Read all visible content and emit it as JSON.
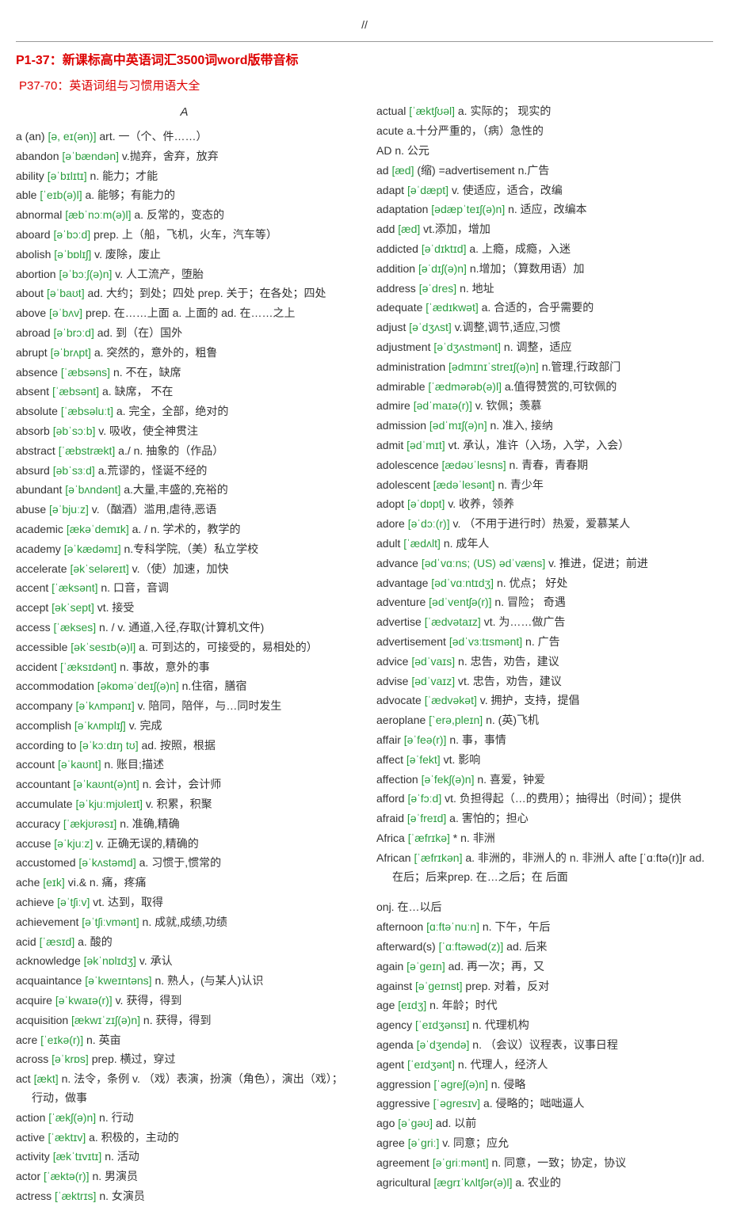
{
  "pageNum": "//",
  "title1": "P1-37：新课标高中英语词汇3500词word版带音标",
  "title2": "P37-70：英语词组与习惯用语大全",
  "sectionHeader": "A",
  "entries": [
    {
      "w": "a (an)",
      "p": "[ə, eɪ(ən)]",
      "d": "art. 一（个、件……）"
    },
    {
      "w": "abandon",
      "p": "[əˈbændən]",
      "d": "v.抛弃，舍弃，放弃"
    },
    {
      "w": "ability",
      "p": "[əˈbɪlɪtɪ]",
      "d": "n. 能力；才能"
    },
    {
      "w": "able",
      "p": "[ˈeɪb(ə)l]",
      "d": "a. 能够；有能力的"
    },
    {
      "w": "abnormal",
      "p": "[æbˈnɔːm(ə)l]",
      "d": "a. 反常的，变态的"
    },
    {
      "w": "aboard",
      "p": "[əˈbɔːd]",
      "d": "prep. 上（船，飞机，火车，汽车等）"
    },
    {
      "w": "abolish",
      "p": "[əˈbɒlɪʃ]",
      "d": "v. 废除，废止"
    },
    {
      "w": "abortion",
      "p": "[əˈbɔːʃ(ə)n]",
      "d": "v. 人工流产，堕胎"
    },
    {
      "w": "about",
      "p": "[əˈbaʊt]",
      "d": "ad. 大约；到处；四处 prep. 关于；在各处；四处"
    },
    {
      "w": "above",
      "p": "[əˈbʌv]",
      "d": "prep. 在……上面 a. 上面的 ad. 在……之上"
    },
    {
      "w": "abroad",
      "p": "[əˈbrɔːd]",
      "d": "ad. 到（在）国外"
    },
    {
      "w": "abrupt",
      "p": "[əˈbrʌpt]",
      "d": "a. 突然的，意外的，粗鲁"
    },
    {
      "w": "absence",
      "p": "[ˈæbsəns]",
      "d": "n. 不在，缺席"
    },
    {
      "w": "absent",
      "p": "[ˈæbsənt]",
      "d": "a. 缺席， 不在"
    },
    {
      "w": "absolute",
      "p": "[ˈæbsəluːt]",
      "d": "a. 完全，全部，绝对的"
    },
    {
      "w": "absorb",
      "p": "[əbˈsɔːb]",
      "d": "v. 吸收，使全神贯注"
    },
    {
      "w": "abstract",
      "p": "[ˈæbstrækt]",
      "d": "a./ n. 抽象的（作品）"
    },
    {
      "w": "absurd",
      "p": "[əbˈsɜːd]",
      "d": "a.荒谬的，怪诞不经的"
    },
    {
      "w": "abundant",
      "p": "[əˈbʌndənt]",
      "d": "a.大量,丰盛的,充裕的"
    },
    {
      "w": "abuse",
      "p": "[əˈbjuːz]",
      "d": "v.（酗酒）滥用,虐待,恶语"
    },
    {
      "w": "academic",
      "p": "[ækəˈdemɪk]",
      "d": "a. / n. 学术的，教学的"
    },
    {
      "w": "academy",
      "p": "[əˈkædəmɪ]",
      "d": "n.专科学院,（美）私立学校"
    },
    {
      "w": "accelerate",
      "p": "[əkˈseləreɪt]",
      "d": "v.（使）加速，加快"
    },
    {
      "w": "accent",
      "p": "[ˈæksənt]",
      "d": "n. 口音，音调"
    },
    {
      "w": "accept",
      "p": "[əkˈsept]",
      "d": "vt. 接受"
    },
    {
      "w": "access",
      "p": "[ˈækses]",
      "d": "n. / v. 通道,入径,存取(计算机文件)"
    },
    {
      "w": "accessible",
      "p": "[əkˈsesɪb(ə)l]",
      "d": "a. 可到达的，可接受的，易相处的）"
    },
    {
      "w": "accident",
      "p": "[ˈæksɪdənt]",
      "d": "n. 事故，意外的事"
    },
    {
      "w": "accommodation",
      "p": "[əkɒməˈdeɪʃ(ə)n]",
      "d": "n.住宿，膳宿"
    },
    {
      "w": "accompany",
      "p": "[əˈkʌmpənɪ]",
      "d": "v. 陪同，陪伴，与…同时发生"
    },
    {
      "w": "accomplish",
      "p": "[əˈkʌmplɪʃ]",
      "d": "v. 完成"
    },
    {
      "w": "according to",
      "p": "[əˈkɔːdɪŋ tʊ]",
      "d": "ad. 按照，根据"
    },
    {
      "w": "account",
      "p": "[əˈkaʊnt]",
      "d": "n. 账目;描述"
    },
    {
      "w": "accountant",
      "p": "[əˈkaʊnt(ə)nt]",
      "d": "n. 会计，会计师"
    },
    {
      "w": "accumulate",
      "p": "[əˈkjuːmjʊleɪt]",
      "d": "v. 积累，积聚"
    },
    {
      "w": "accuracy",
      "p": "[ˈækjʊrəsɪ]",
      "d": "n. 准确,精确"
    },
    {
      "w": "accuse",
      "p": "[əˈkjuːz]",
      "d": "v. 正确无误的,精确的"
    },
    {
      "w": "accustomed",
      "p": "[əˈkʌstəmd]",
      "d": "a. 习惯于,惯常的"
    },
    {
      "w": "ache",
      "p": "[eɪk]",
      "d": "vi.& n. 痛，疼痛"
    },
    {
      "w": "achieve",
      "p": "[əˈtʃiːv]",
      "d": "vt. 达到，取得"
    },
    {
      "w": "achievement",
      "p": "[əˈtʃiːvmənt]",
      "d": "n. 成就,成绩,功绩"
    },
    {
      "w": "acid",
      "p": "[ˈæsɪd]",
      "d": "a. 酸的"
    },
    {
      "w": "acknowledge",
      "p": "[əkˈnɒlɪdʒ]",
      "d": "v. 承认"
    },
    {
      "w": "acquaintance",
      "p": "[əˈkweɪntəns]",
      "d": "n. 熟人，(与某人)认识"
    },
    {
      "w": "acquire",
      "p": "[əˈkwaɪə(r)]",
      "d": "v. 获得，得到"
    },
    {
      "w": "acquisition",
      "p": "[ækwɪˈzɪʃ(ə)n]",
      "d": "n. 获得，得到"
    },
    {
      "w": "acre",
      "p": "[ˈeɪkə(r)]",
      "d": "n. 英亩"
    },
    {
      "w": "across",
      "p": "[əˈkrɒs]",
      "d": "prep. 横过，穿过"
    },
    {
      "w": "act",
      "p": "[ækt]",
      "d": "n. 法令，条例 v. （戏）表演，扮演（角色），演出（戏）；行动，做事"
    },
    {
      "w": "action",
      "p": "[ˈækʃ(ə)n]",
      "d": "n. 行动"
    },
    {
      "w": "active",
      "p": "[ˈæktɪv]",
      "d": "a. 积极的，主动的"
    },
    {
      "w": "activity",
      "p": "[ækˈtɪvɪtɪ]",
      "d": "n. 活动"
    },
    {
      "w": "actor",
      "p": "[ˈæktə(r)]",
      "d": "n. 男演员"
    },
    {
      "w": "actress",
      "p": "[ˈæktrɪs]",
      "d": "n. 女演员"
    },
    {
      "w": "actual",
      "p": "[ˈæktʃʊəl]",
      "d": "a. 实际的； 现实的"
    },
    {
      "w": "acute",
      "p": "",
      "d": "a.十分严重的，（病）急性的"
    },
    {
      "w": "AD",
      "p": "",
      "d": "n. 公元"
    },
    {
      "w": "ad",
      "p": "[æd]",
      "d": "(缩) =advertisement n.广告"
    },
    {
      "w": "adapt",
      "p": "[əˈdæpt]",
      "d": "v. 使适应，适合，改编"
    },
    {
      "w": "adaptation",
      "p": "[ədæpˈteɪʃ(ə)n]",
      "d": "n. 适应，改编本"
    },
    {
      "w": "add",
      "p": "[æd]",
      "d": "vt.添加，增加"
    },
    {
      "w": "addicted",
      "p": "[əˈdɪktɪd]",
      "d": "a. 上瘾，成瘾，入迷"
    },
    {
      "w": "addition",
      "p": "[əˈdɪʃ(ə)n]",
      "d": "n.增加；（算数用语）加"
    },
    {
      "w": "address",
      "p": "[əˈdres]",
      "d": "n. 地址"
    },
    {
      "w": "adequate",
      "p": "[ˈædɪkwət]",
      "d": "a. 合适的，合乎需要的"
    },
    {
      "w": "adjust",
      "p": "[əˈdʒʌst]",
      "d": "v.调整,调节,适应,习惯"
    },
    {
      "w": "adjustment",
      "p": "[əˈdʒʌstmənt]",
      "d": "n. 调整，适应"
    },
    {
      "w": "administration",
      "p": "[ədmɪnɪˈstreɪʃ(ə)n]",
      "d": "n.管理,行政部门"
    },
    {
      "w": "admirable",
      "p": "[ˈædmərəb(ə)l]",
      "d": "a.值得赞赏的,可钦佩的"
    },
    {
      "w": "admire",
      "p": "[ədˈmaɪə(r)]",
      "d": "v. 钦佩；羡慕"
    },
    {
      "w": "admission",
      "p": "[ədˈmɪʃ(ə)n]",
      "d": "n. 准入, 接纳"
    },
    {
      "w": "admit",
      "p": "[ədˈmɪt]",
      "d": "vt. 承认，准许（入场，入学，入会）"
    },
    {
      "w": "adolescence",
      "p": "[ædəʊˈlesns]",
      "d": "n. 青春，青春期"
    },
    {
      "w": "adolescent",
      "p": "[ædəˈlesənt]",
      "d": "n. 青少年"
    },
    {
      "w": "adopt",
      "p": "[əˈdɒpt]",
      "d": "v. 收养，领养"
    },
    {
      "w": "adore",
      "p": "[əˈdɔː(r)]",
      "d": "v. （不用于进行时）热爱，爱慕某人"
    },
    {
      "w": "adult",
      "p": "[ˈædʌlt]",
      "d": "n. 成年人"
    },
    {
      "w": "advance",
      "p": "[ədˈvɑːns; (US) ədˈvæns]",
      "d": "v. 推进，促进；前进"
    },
    {
      "w": "advantage",
      "p": "[ədˈvɑːntɪdʒ]",
      "d": "n. 优点； 好处"
    },
    {
      "w": "adventure",
      "p": "[ədˈventʃə(r)]",
      "d": "n. 冒险； 奇遇"
    },
    {
      "w": "advertise",
      "p": "[ˈædvətaɪz]",
      "d": "vt. 为……做广告"
    },
    {
      "w": "advertisement",
      "p": "[ədˈvɜːtɪsmənt]",
      "d": "n. 广告"
    },
    {
      "w": "advice",
      "p": "[ədˈvaɪs]",
      "d": "n. 忠告，劝告，建议"
    },
    {
      "w": "advise",
      "p": "[ədˈvaɪz]",
      "d": "vt. 忠告，劝告，建议"
    },
    {
      "w": "advocate",
      "p": "[ˈædvəkət]",
      "d": "v. 拥护，支持，提倡"
    },
    {
      "w": "aeroplane",
      "p": "[`erə,pleɪn]",
      "d": "n. (英)飞机"
    },
    {
      "w": "affair",
      "p": "[əˈfeə(r)]",
      "d": "n. 事，事情"
    },
    {
      "w": "affect",
      "p": "[əˈfekt]",
      "d": "vt. 影响"
    },
    {
      "w": "affection",
      "p": "[əˈfekʃ(ə)n]",
      "d": "n. 喜爱，钟爱"
    },
    {
      "w": "afford",
      "p": "[əˈfɔːd]",
      "d": "vt. 负担得起（…的费用）；抽得出（时间）；提供"
    },
    {
      "w": "afraid",
      "p": "[əˈfreɪd]",
      "d": "a. 害怕的；担心"
    },
    {
      "w": "Africa",
      "p": "[ˈæfrɪkə]",
      "d": "* n. 非洲"
    },
    {
      "w": "African",
      "p": "[ˈæfrɪkən]",
      "d": "a. 非洲的，非洲人的 n. 非洲人 afte [ˈɑːftə(r)]r ad. 在后；后来prep. 在…之后；在 后面"
    },
    {
      "w": "",
      "p": "",
      "d": "",
      "spacer": true
    },
    {
      "w": "onj.",
      "p": "",
      "d": "在…以后"
    },
    {
      "w": "afternoon",
      "p": "[ɑːftəˈnuːn]",
      "d": "n. 下午，午后"
    },
    {
      "w": "afterward(s)",
      "p": "[ˈɑːftəwəd(z)]",
      "d": "ad. 后来"
    },
    {
      "w": "again",
      "p": "[əˈɡeɪn]",
      "d": "ad. 再一次；再，又"
    },
    {
      "w": "against",
      "p": "[əˈɡeɪnst]",
      "d": "prep. 对着，反对"
    },
    {
      "w": "age",
      "p": "[eɪdʒ]",
      "d": "n. 年龄；时代"
    },
    {
      "w": "agency",
      "p": "[ˈeɪdʒənsɪ]",
      "d": "n. 代理机构"
    },
    {
      "w": "agenda",
      "p": "[əˈdʒendə]",
      "d": "n. （会议）议程表，议事日程"
    },
    {
      "w": "agent",
      "p": "[ˈeɪdʒənt]",
      "d": "n. 代理人，经济人"
    },
    {
      "w": "aggression",
      "p": "[ˈəɡreʃ(ə)n]",
      "d": "n. 侵略"
    },
    {
      "w": "aggressive",
      "p": "[ˈəɡresɪv]",
      "d": "a. 侵略的；咄咄逼人"
    },
    {
      "w": "ago",
      "p": "[əˈɡəʊ]",
      "d": "ad. 以前"
    },
    {
      "w": "agree",
      "p": "[əˈɡriː]",
      "d": "v. 同意；应允"
    },
    {
      "w": "agreement",
      "p": "[əˈɡriːmənt]",
      "d": "n. 同意，一致；协定，协议"
    },
    {
      "w": "agricultural",
      "p": "[æɡrɪˈkʌltʃər(ə)l]",
      "d": "a. 农业的"
    }
  ]
}
